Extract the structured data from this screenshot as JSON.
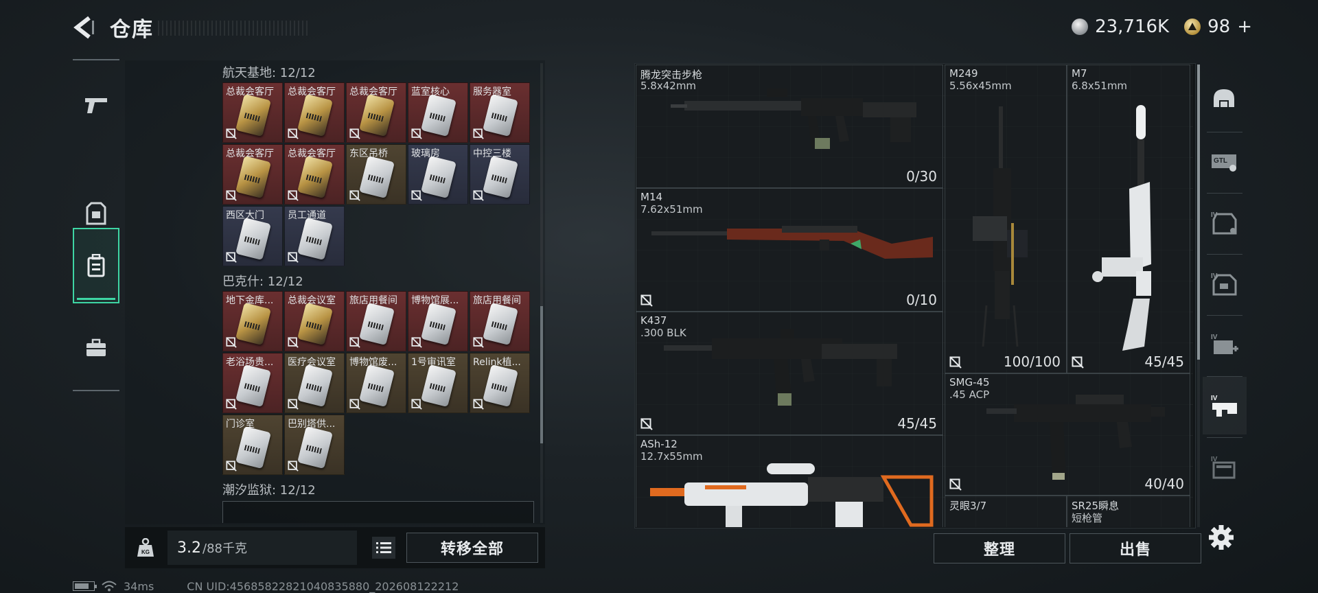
{
  "header": {
    "title": "仓库"
  },
  "currency": {
    "silver": "23,716K",
    "gold": "98",
    "add_symbol": "+"
  },
  "side_nav": {
    "items": [
      {
        "icon": "pistol-icon"
      },
      {
        "icon": "armor-icon"
      },
      {
        "icon": "backpack-icon"
      },
      {
        "icon": "briefcase-icon"
      }
    ],
    "active_index": 2
  },
  "key_sections": [
    {
      "title": "航天基地: 12/12",
      "keys": [
        {
          "name": "总裁会客厅",
          "color": "red",
          "card": "gold"
        },
        {
          "name": "总裁会客厅",
          "color": "red",
          "card": "gold"
        },
        {
          "name": "总裁会客厅",
          "color": "red",
          "card": "gold"
        },
        {
          "name": "蓝室核心",
          "color": "red",
          "card": "silver"
        },
        {
          "name": "服务器室",
          "color": "red",
          "card": "silver"
        },
        {
          "name": "总裁会客厅",
          "color": "red",
          "card": "gold"
        },
        {
          "name": "总裁会客厅",
          "color": "red",
          "card": "gold"
        },
        {
          "name": "东区吊桥",
          "color": "gold",
          "card": "silver"
        },
        {
          "name": "玻璃房",
          "color": "blue",
          "card": "silver"
        },
        {
          "name": "中控三楼",
          "color": "blue",
          "card": "silver"
        },
        {
          "name": "西区大门",
          "color": "blue",
          "card": "silver"
        },
        {
          "name": "员工通道",
          "color": "blue",
          "card": "silver"
        }
      ]
    },
    {
      "title": "巴克什: 12/12",
      "keys": [
        {
          "name": "地下金库...",
          "color": "red",
          "card": "gold"
        },
        {
          "name": "总裁会议室",
          "color": "red",
          "card": "gold"
        },
        {
          "name": "旅店用餐间",
          "color": "red",
          "card": "silver"
        },
        {
          "name": "博物馆展...",
          "color": "red",
          "card": "silver"
        },
        {
          "name": "旅店用餐间",
          "color": "red",
          "card": "silver"
        },
        {
          "name": "老浴场贵...",
          "color": "red",
          "card": "silver"
        },
        {
          "name": "医疗会议室",
          "color": "gold",
          "card": "silver"
        },
        {
          "name": "博物馆废...",
          "color": "gold",
          "card": "silver"
        },
        {
          "name": "1号审讯室",
          "color": "gold",
          "card": "silver"
        },
        {
          "name": "Relink植...",
          "color": "gold",
          "card": "silver"
        },
        {
          "name": "门诊室",
          "color": "gold",
          "card": "silver"
        },
        {
          "name": "巴别塔供...",
          "color": "gold",
          "card": "silver"
        }
      ]
    },
    {
      "title": "潮汐监狱: 12/12",
      "keys": []
    }
  ],
  "weight": {
    "current": "3.2",
    "max": "/88千克"
  },
  "buttons": {
    "transfer_all": "转移全部",
    "sort": "整理",
    "sell": "出售"
  },
  "status": {
    "ping": "34ms",
    "uid": "CN UID:456858228210408358​80_202608122212"
  },
  "weapons": [
    {
      "name": "腾龙突击步枪",
      "caliber": "5.8x42mm",
      "ammo": "0/30",
      "locked": false,
      "shape": "rifle"
    },
    {
      "name": "M249",
      "caliber": "5.56x45mm",
      "ammo": "100/100",
      "locked": true,
      "shape": "lmg"
    },
    {
      "name": "M7",
      "caliber": "6.8x51mm",
      "ammo": "45/45",
      "locked": true,
      "shape": "m7"
    },
    {
      "name": "M14",
      "caliber": "7.62x51mm",
      "ammo": "0/10",
      "locked": true,
      "shape": "m14"
    },
    {
      "name": "K437",
      "caliber": ".300 BLK",
      "ammo": "45/45",
      "locked": true,
      "shape": "k437"
    },
    {
      "name": "SMG-45",
      "caliber": ".45 ACP",
      "ammo": "40/40",
      "locked": true,
      "shape": "smg"
    },
    {
      "name": "ASh-12",
      "caliber": "12.7x55mm",
      "ammo": "",
      "locked": false,
      "shape": "ash"
    },
    {
      "name": "灵眼3/7",
      "caliber": "",
      "ammo": "",
      "locked": false,
      "shape": ""
    },
    {
      "name": "SR25瞬息",
      "caliber": "短枪管",
      "ammo": "",
      "locked": false,
      "shape": ""
    }
  ],
  "categories": [
    {
      "icon": "helmet-icon"
    },
    {
      "icon": "gtl-loader-icon"
    },
    {
      "icon": "iv-vest-icon"
    },
    {
      "icon": "iv-armor-icon"
    },
    {
      "icon": "iv-medkit-icon"
    },
    {
      "icon": "iv-rifle-icon"
    },
    {
      "icon": "iv-folder-icon"
    }
  ],
  "category_active_index": 5,
  "colors": {
    "accent": "#3ed6a4",
    "key_red": "#6a2f30",
    "key_gold": "#4f4431",
    "key_blue": "#353a4d"
  }
}
